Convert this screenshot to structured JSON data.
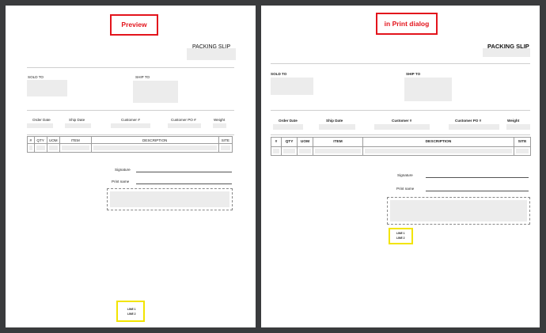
{
  "panels": {
    "left": {
      "tag": "Preview",
      "title": "PACKING SLIP",
      "sold_to": "SOLD TO",
      "ship_to": "SHIP TO",
      "order_fields": [
        "Order Date",
        "Ship Date",
        "Customer #",
        "Customer PO #",
        "Weight"
      ],
      "columns": [
        "#",
        "QTY",
        "UOM",
        "ITEM",
        "DESCRIPTION",
        "SITE"
      ],
      "signature": "Signature",
      "print_name": "Print name",
      "lines": [
        "LINE 1",
        "LINE 2"
      ]
    },
    "right": {
      "tag": "in Print dialog",
      "title": "PACKING SLIP",
      "sold_to": "SOLD TO",
      "ship_to": "SHIP TO",
      "order_fields": [
        "Order Date",
        "Ship Date",
        "Customer #",
        "Customer PO #",
        "Weight"
      ],
      "columns": [
        "#",
        "QTY",
        "UOM",
        "ITEM",
        "DESCRIPTION",
        "SITE"
      ],
      "signature": "Signature",
      "print_name": "Print name",
      "lines": [
        "LINE 1",
        "LINE 2"
      ]
    }
  },
  "colors": {
    "background": "#3a3b3d",
    "tag_border": "#e3141c",
    "highlight_border": "#f2e400",
    "placeholder": "#ececec"
  }
}
